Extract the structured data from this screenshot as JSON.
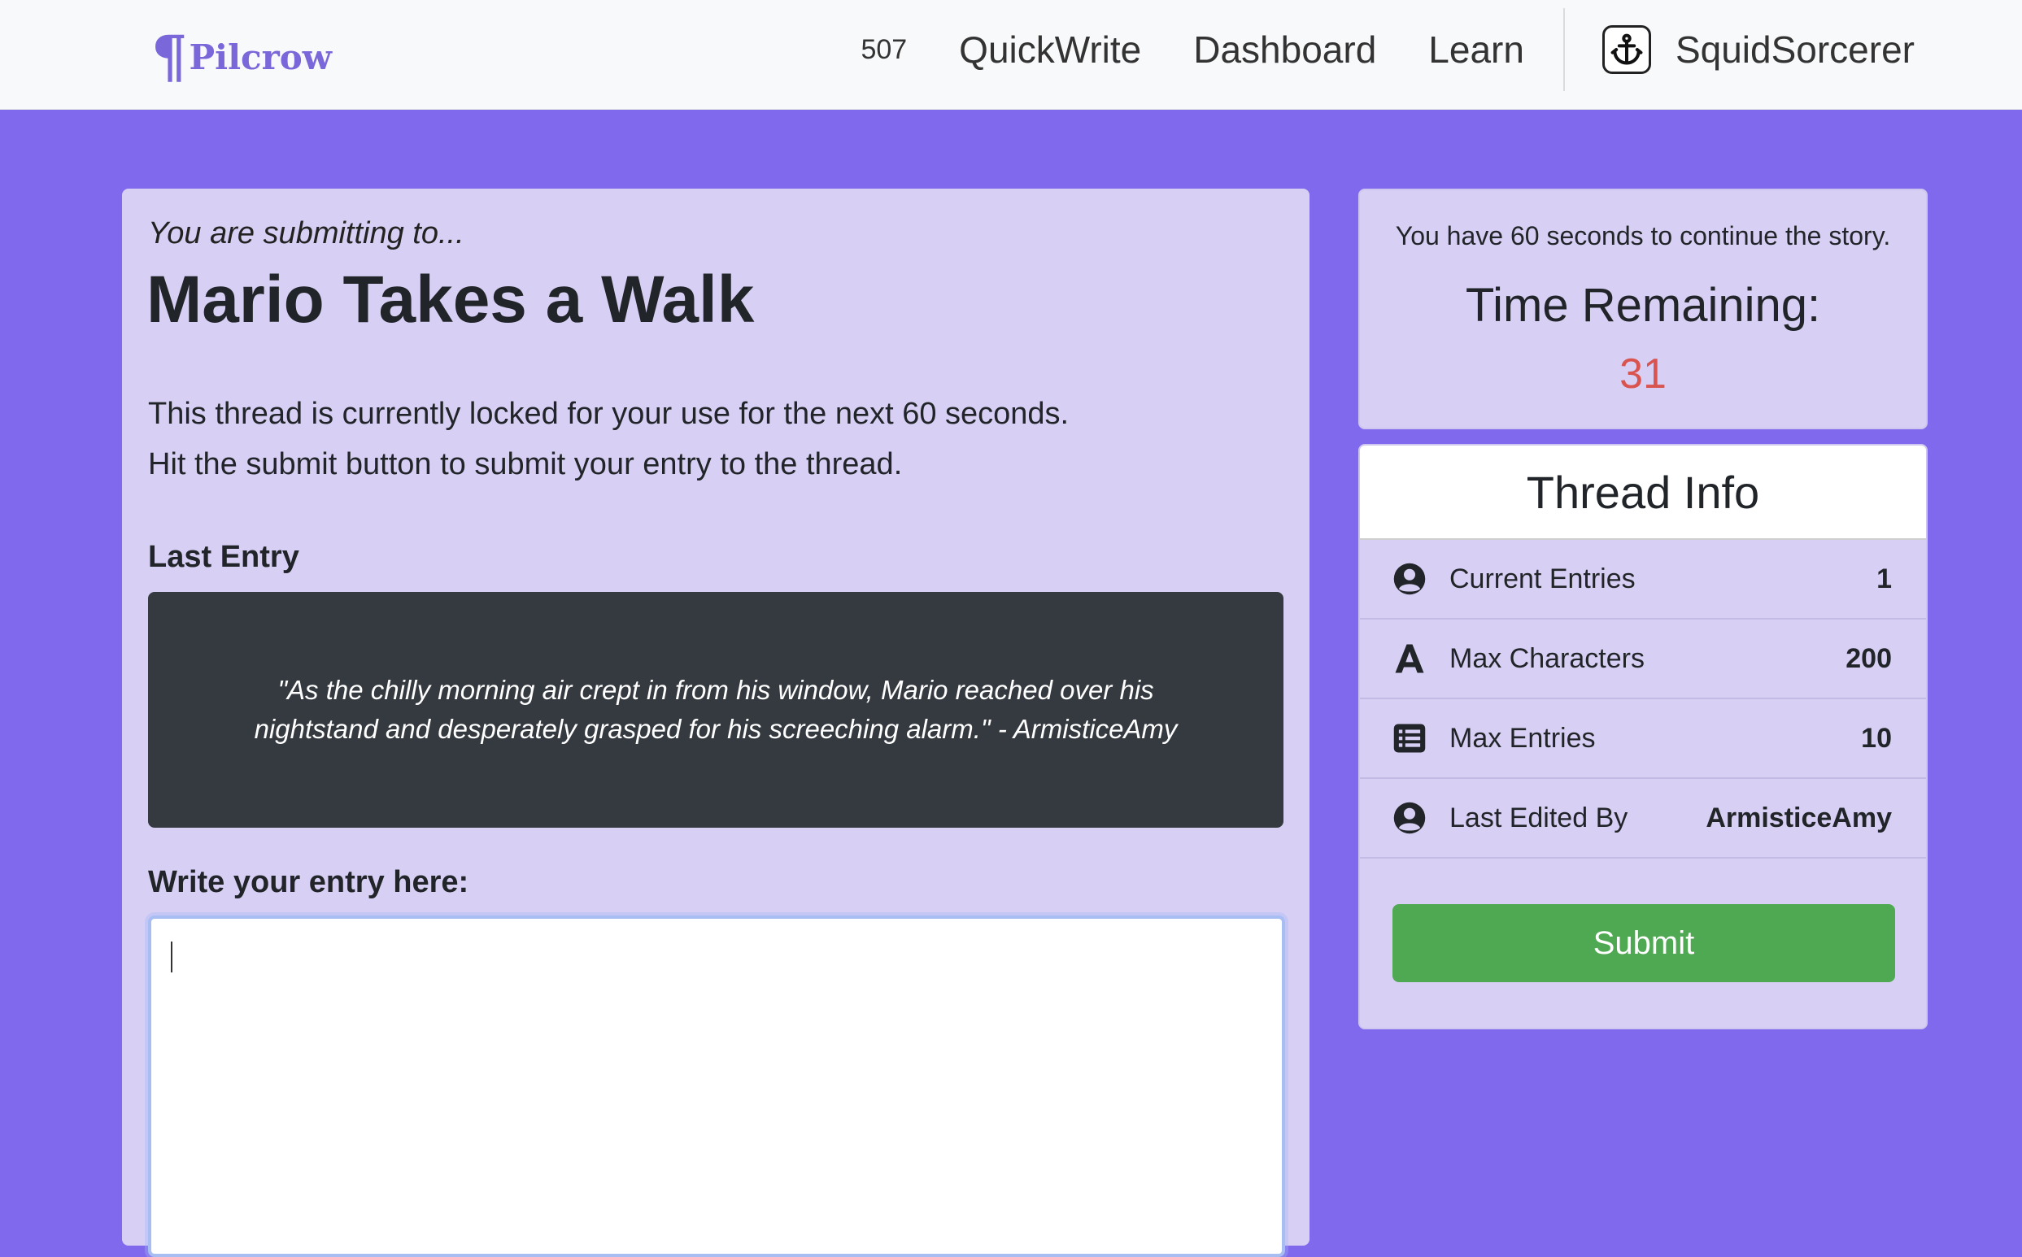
{
  "navbar": {
    "brand_mark": "¶",
    "brand_name": "Pilcrow",
    "count": "507",
    "links": [
      "QuickWrite",
      "Dashboard",
      "Learn"
    ],
    "user_icon": "anchor-icon",
    "username": "SquidSorcerer"
  },
  "main": {
    "submitting_to": "You are submitting to...",
    "thread_title": "Mario Takes a Walk",
    "info_line_1": "This thread is currently locked for your use for the next 60 seconds.",
    "info_line_2": "Hit the submit button to submit your entry to the thread.",
    "last_entry_label": "Last Entry",
    "last_entry_text": "\"As the chilly morning air crept in from his window, Mario reached over his nightstand and desperately grasped for his screeching alarm.\" - ArmisticeAmy",
    "write_label": "Write your entry here:",
    "entry_value": ""
  },
  "timer": {
    "note": "You have 60 seconds to continue the story.",
    "heading": "Time Remaining:",
    "value": "31",
    "value_color": "#d9534f"
  },
  "thread_info": {
    "title": "Thread Info",
    "rows": [
      {
        "icon": "user-circle-icon",
        "label": "Current Entries",
        "value": "1"
      },
      {
        "icon": "font-letter-icon",
        "label": "Max Characters",
        "value": "200"
      },
      {
        "icon": "list-icon",
        "label": "Max Entries",
        "value": "10"
      },
      {
        "icon": "user-circle-icon",
        "label": "Last Edited By",
        "value": "ArmisticeAmy"
      }
    ],
    "submit_label": "Submit",
    "submit_color": "#4fa852"
  },
  "colors": {
    "background": "#8069ec",
    "card": "#d8d0f4",
    "brand": "#7a67d9",
    "dark_box": "#343a40"
  }
}
